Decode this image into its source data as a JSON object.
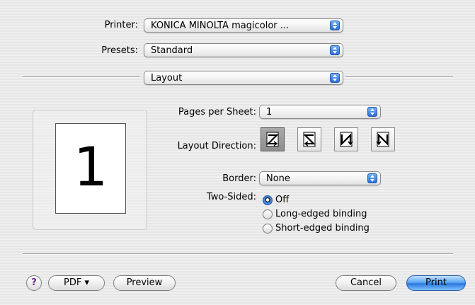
{
  "printer": {
    "label": "Printer:",
    "value": "KONICA MINOLTA magicolor ..."
  },
  "presets": {
    "label": "Presets:",
    "value": "Standard"
  },
  "panel": {
    "value": "Layout"
  },
  "preview": {
    "page_number": "1"
  },
  "pages_per_sheet": {
    "label": "Pages per Sheet:",
    "value": "1"
  },
  "layout_direction": {
    "label": "Layout Direction:",
    "options": [
      "left-to-right-z",
      "right-to-left-reverse-z",
      "top-to-bottom-n",
      "top-to-bottom-reverse-n"
    ],
    "selected_index": 0
  },
  "border": {
    "label": "Border:",
    "value": "None"
  },
  "two_sided": {
    "label": "Two-Sided:",
    "options": [
      "Off",
      "Long-edged binding",
      "Short-edged binding"
    ],
    "selected_index": 0
  },
  "footer": {
    "help": "?",
    "pdf": "PDF ▾",
    "preview": "Preview",
    "cancel": "Cancel",
    "print": "Print"
  },
  "colors": {
    "accent_blue": "#2b77e0",
    "background": "#ececec"
  }
}
